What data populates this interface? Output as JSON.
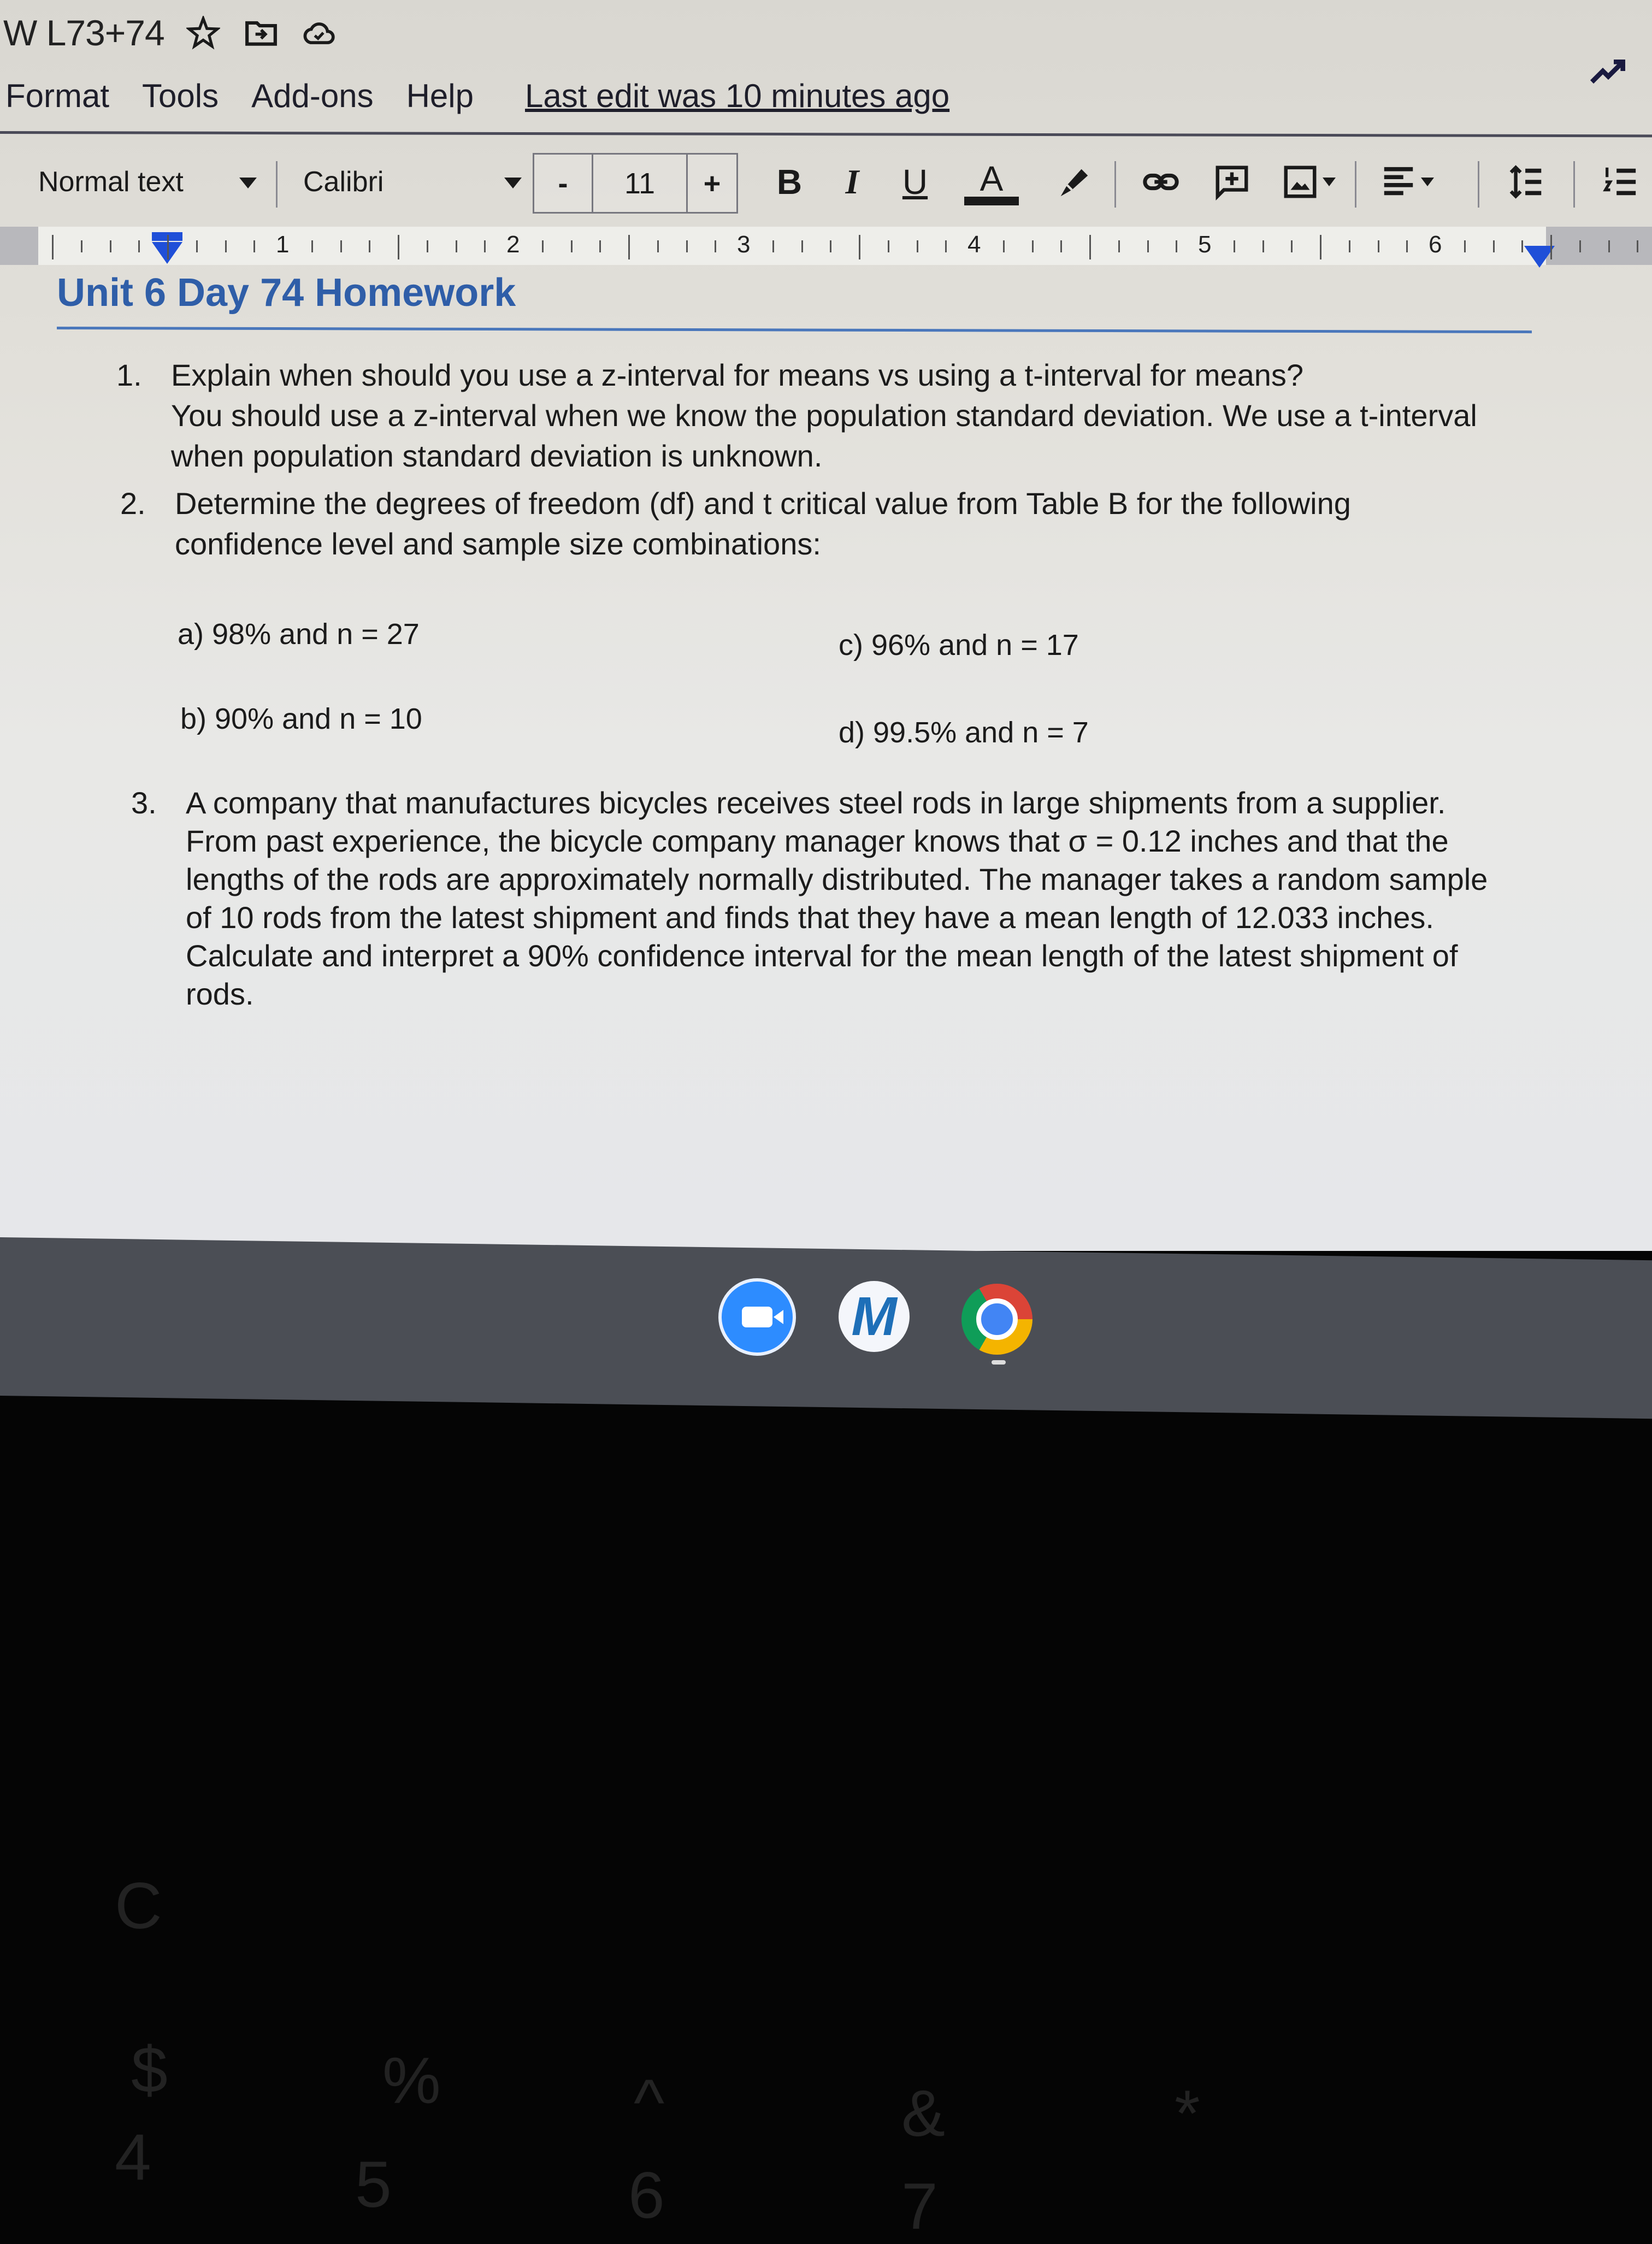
{
  "window": {
    "doc_title": "W L73+74",
    "title_icons": [
      "star-icon",
      "move-to-folder-icon",
      "cloud-saved-icon"
    ]
  },
  "menu": {
    "items": [
      "Format",
      "Tools",
      "Add-ons",
      "Help"
    ],
    "last_edit": "Last edit was 10 minutes ago",
    "activity_icon": "activity-trend-icon"
  },
  "toolbar": {
    "paragraph_style": "Normal text",
    "font": "Calibri",
    "font_size": "11",
    "minus_label": "-",
    "plus_label": "+",
    "bold_label": "B",
    "italic_label": "I",
    "underline_label": "U",
    "text_color_label": "A",
    "icons": [
      "highlight-pen-icon",
      "link-icon",
      "add-comment-icon",
      "insert-image-icon",
      "align-icon",
      "line-spacing-icon",
      "numbered-list-icon"
    ]
  },
  "ruler": {
    "numbers": [
      "1",
      "2",
      "3",
      "4",
      "5",
      "6"
    ]
  },
  "document": {
    "heading": "Unit 6 Day 74 Homework",
    "questions": [
      {
        "number": "1.",
        "lines": [
          "Explain when should you use a z-interval for means vs using a t-interval for means?",
          "You should use a z-interval when we know the population standard deviation. We use a t-interval",
          "when population standard deviation is unknown."
        ]
      },
      {
        "number": "2.",
        "lines": [
          "Determine the degrees of freedom (df) and t critical value from Table B for the following",
          "confidence level and sample size combinations:"
        ],
        "parts": [
          "a) 98% and n = 27",
          "b) 90% and n = 10",
          "c) 96% and n = 17",
          "d) 99.5% and n = 7"
        ]
      },
      {
        "number": "3.",
        "lines": [
          "A company that manufactures bicycles receives steel rods in large shipments from a supplier.",
          "From past experience, the bicycle company manager knows that σ = 0.12 inches and that the",
          "lengths of the rods are approximately normally distributed. The manager takes a random sample",
          "of 10 rods from the latest shipment and finds that they have a mean length of 12.033 inches.",
          "Calculate and interpret a 90% confidence interval for the mean length of the latest shipment of",
          "rods."
        ]
      }
    ]
  },
  "shelf": {
    "apps": [
      "Zoom",
      "M",
      "Chrome"
    ]
  },
  "keyboard_reflection": [
    "C",
    "$",
    "%",
    "^",
    "&",
    "*",
    "4",
    "5",
    "6",
    "7"
  ],
  "colors": {
    "heading_blue": "#2f5ea8",
    "ruler_marker_blue": "#1f4fd8",
    "shelf_gray": "#4b4e55"
  }
}
